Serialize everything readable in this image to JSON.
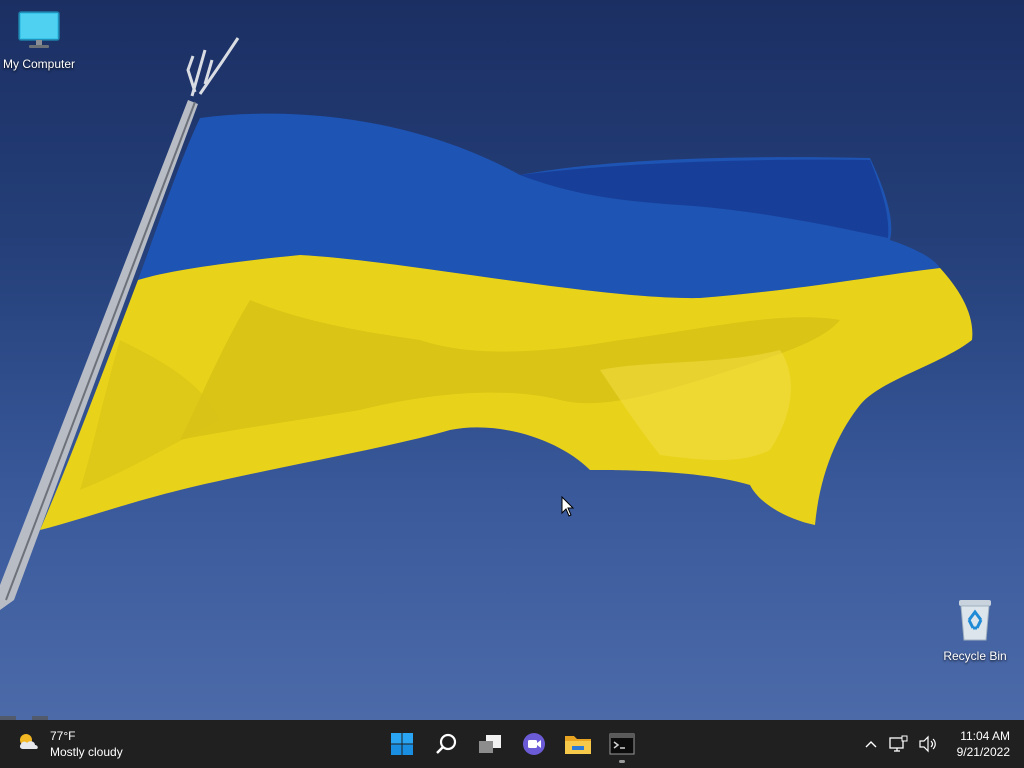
{
  "desktop": {
    "icons": [
      {
        "label": "My Computer",
        "icon": "monitor-icon"
      },
      {
        "label": "Recycle Bin",
        "icon": "recycle-bin-icon"
      }
    ],
    "wallpaper": {
      "flag_blue": "#1f56b8",
      "flag_yellow": "#e8d21c",
      "sky_top": "#1b2f63",
      "sky_bottom": "#4c6aa8"
    }
  },
  "taskbar": {
    "background": "#202020",
    "weather": {
      "temp": "77°F",
      "condition": "Mostly cloudy",
      "icon": "partly-cloudy-icon"
    },
    "pinned": [
      {
        "name": "start",
        "icon": "windows-logo-icon"
      },
      {
        "name": "search",
        "icon": "search-icon"
      },
      {
        "name": "task-view",
        "icon": "task-view-icon"
      },
      {
        "name": "chat",
        "icon": "teams-chat-icon"
      },
      {
        "name": "file-explorer",
        "icon": "folder-icon"
      },
      {
        "name": "terminal",
        "icon": "terminal-icon"
      }
    ],
    "tray": {
      "icons": [
        "chevron-up-icon",
        "network-icon",
        "speaker-icon"
      ],
      "time": "11:04 AM",
      "date": "9/21/2022"
    }
  }
}
